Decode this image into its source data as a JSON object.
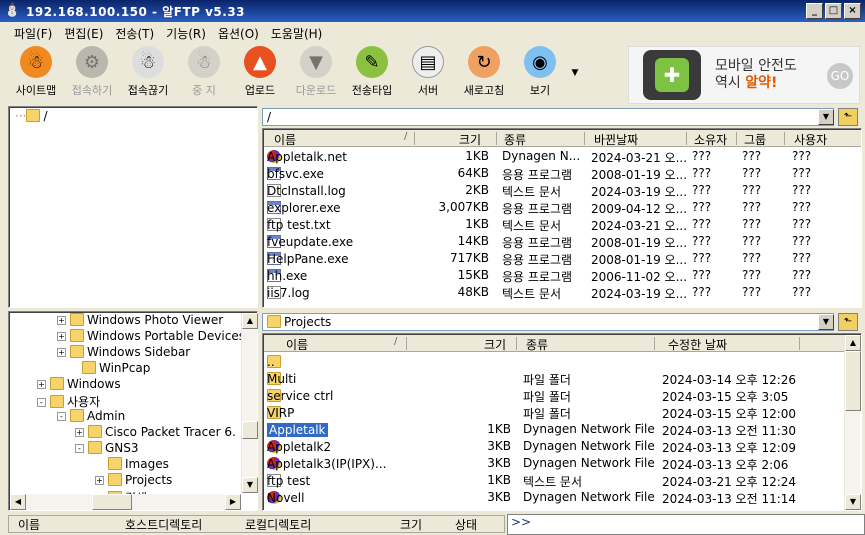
{
  "window": {
    "title": "192.168.100.150 - 알FTP v5.33"
  },
  "menu": [
    "파일(F)",
    "편집(E)",
    "전송(T)",
    "기능(R)",
    "옵션(O)",
    "도움말(H)"
  ],
  "toolbar": [
    {
      "label": "사이트맵",
      "icon": "sitemap-icon",
      "enabled": true
    },
    {
      "label": "접속하기",
      "icon": "connect-icon",
      "enabled": false
    },
    {
      "label": "접속끊기",
      "icon": "disconnect-icon",
      "enabled": true
    },
    {
      "label": "중 지",
      "icon": "stop-icon",
      "enabled": false
    },
    {
      "label": "업로드",
      "icon": "upload-icon",
      "enabled": true
    },
    {
      "label": "다운로드",
      "icon": "download-icon",
      "enabled": false
    },
    {
      "label": "전송타입",
      "icon": "transfer-type-icon",
      "enabled": true
    },
    {
      "label": "서버",
      "icon": "server-icon",
      "enabled": true
    },
    {
      "label": "새로고침",
      "icon": "refresh-icon",
      "enabled": true
    },
    {
      "label": "보기",
      "icon": "view-icon",
      "enabled": true
    }
  ],
  "ad": {
    "line1": "모바일 안전도",
    "line2_prefix": "역시 ",
    "line2_brand": "알약!",
    "go": "GO"
  },
  "remote": {
    "tree_root": "/",
    "path": "/",
    "columns": [
      "이름",
      "크기",
      "종류",
      "바뀐날짜",
      "소유자",
      "그룹",
      "사용자"
    ],
    "files": [
      {
        "icon": "dyn",
        "name": "Appletalk.net",
        "size": "1KB",
        "type": "Dynagen N...",
        "date": "2024-03-21 오...",
        "owner": "???",
        "group": "???",
        "user": "???"
      },
      {
        "icon": "app",
        "name": "bfsvc.exe",
        "size": "64KB",
        "type": "응용 프로그램",
        "date": "2008-01-19 오...",
        "owner": "???",
        "group": "???",
        "user": "???"
      },
      {
        "icon": "txt",
        "name": "DtcInstall.log",
        "size": "2KB",
        "type": "텍스트 문서",
        "date": "2024-03-19 오...",
        "owner": "???",
        "group": "???",
        "user": "???"
      },
      {
        "icon": "app",
        "name": "explorer.exe",
        "size": "3,007KB",
        "type": "응용 프로그램",
        "date": "2009-04-12 오...",
        "owner": "???",
        "group": "???",
        "user": "???"
      },
      {
        "icon": "txt",
        "name": "ftp test.txt",
        "size": "1KB",
        "type": "텍스트 문서",
        "date": "2024-03-21 오...",
        "owner": "???",
        "group": "???",
        "user": "???"
      },
      {
        "icon": "app",
        "name": "fveupdate.exe",
        "size": "14KB",
        "type": "응용 프로그램",
        "date": "2008-01-19 오...",
        "owner": "???",
        "group": "???",
        "user": "???"
      },
      {
        "icon": "app",
        "name": "HelpPane.exe",
        "size": "717KB",
        "type": "응용 프로그램",
        "date": "2008-01-19 오...",
        "owner": "???",
        "group": "???",
        "user": "???"
      },
      {
        "icon": "app",
        "name": "hh.exe",
        "size": "15KB",
        "type": "응용 프로그램",
        "date": "2006-11-02 오...",
        "owner": "???",
        "group": "???",
        "user": "???"
      },
      {
        "icon": "txt",
        "name": "iis7.log",
        "size": "48KB",
        "type": "텍스트 문서",
        "date": "2024-03-19 오...",
        "owner": "???",
        "group": "???",
        "user": "???"
      }
    ]
  },
  "local": {
    "tree": [
      {
        "label": "Windows Photo Viewer",
        "toggle": "+"
      },
      {
        "label": "Windows Portable Devices",
        "toggle": "+"
      },
      {
        "label": "Windows Sidebar",
        "toggle": "+"
      },
      {
        "label": "WinPcap",
        "toggle": ""
      },
      {
        "label": "Windows",
        "toggle": "+"
      },
      {
        "label": "사용자",
        "toggle": "-"
      },
      {
        "label": "Admin",
        "toggle": "-"
      },
      {
        "label": "Cisco Packet Tracer 6.",
        "toggle": "+"
      },
      {
        "label": "GNS3",
        "toggle": "-"
      },
      {
        "label": "Images",
        "toggle": ""
      },
      {
        "label": "Projects",
        "toggle": "+"
      },
      {
        "label": "검색",
        "toggle": ""
      }
    ],
    "path": "Projects",
    "columns": [
      "이름",
      "크기",
      "종류",
      "수정한 날짜"
    ],
    "files": [
      {
        "icon": "folder",
        "name": "..",
        "size": "",
        "type": "",
        "date": ""
      },
      {
        "icon": "folder",
        "name": "Multi",
        "size": "",
        "type": "파일 폴더",
        "date": "2024-03-14 오후 12:26"
      },
      {
        "icon": "folder",
        "name": "service ctrl",
        "size": "",
        "type": "파일 폴더",
        "date": "2024-03-15 오후 3:05"
      },
      {
        "icon": "folder",
        "name": "VIRP",
        "size": "",
        "type": "파일 폴더",
        "date": "2024-03-15 오후 12:00"
      },
      {
        "icon": "txt",
        "name": "Appletalk",
        "size": "1KB",
        "type": "Dynagen Network File",
        "date": "2024-03-13 오전 11:30",
        "selected": true
      },
      {
        "icon": "dyn",
        "name": "Appletalk2",
        "size": "3KB",
        "type": "Dynagen Network File",
        "date": "2024-03-13 오후 12:09"
      },
      {
        "icon": "dyn",
        "name": "Appletalk3(IP(IPX)...",
        "size": "3KB",
        "type": "Dynagen Network File",
        "date": "2024-03-13 오후 2:06"
      },
      {
        "icon": "txt",
        "name": "ftp test",
        "size": "1KB",
        "type": "텍스트 문서",
        "date": "2024-03-21 오후 12:24"
      },
      {
        "icon": "dyn",
        "name": "Novell",
        "size": "3KB",
        "type": "Dynagen Network File",
        "date": "2024-03-13 오전 11:14"
      }
    ]
  },
  "queue_columns": [
    "이름",
    "호스트디렉토리",
    "로컬디렉토리",
    "크기",
    "상태"
  ],
  "log_prompt": ">>"
}
